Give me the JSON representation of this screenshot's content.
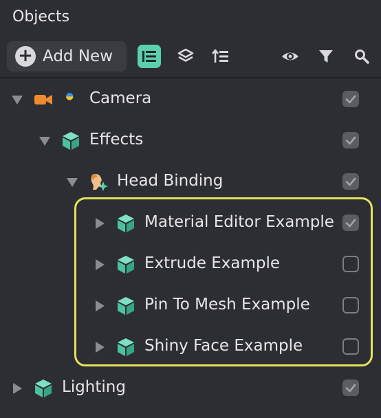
{
  "panel": {
    "title": "Objects"
  },
  "toolbar": {
    "add_label": "Add New",
    "icons": [
      "list-tree-icon",
      "layers-icon",
      "sort-hierarchy-icon",
      "eye-icon",
      "filter-icon",
      "search-icon"
    ],
    "active_icon": "list-tree-icon",
    "accent": "#5ad0ae"
  },
  "tree": [
    {
      "label": "Camera",
      "expanded": true,
      "icon": "camera-icon",
      "checked": true,
      "depth": 0
    },
    {
      "label": "Effects",
      "expanded": true,
      "icon": "cube-icon",
      "checked": true,
      "depth": 1
    },
    {
      "label": "Head Binding",
      "expanded": true,
      "icon": "head-binding-icon",
      "checked": true,
      "depth": 2
    },
    {
      "label": "Material Editor Example",
      "expanded": false,
      "icon": "cube-icon",
      "checked": true,
      "depth": 3
    },
    {
      "label": "Extrude Example",
      "expanded": false,
      "icon": "cube-icon",
      "checked": false,
      "depth": 3
    },
    {
      "label": "Pin To Mesh Example",
      "expanded": false,
      "icon": "cube-icon",
      "checked": false,
      "depth": 3
    },
    {
      "label": "Shiny Face Example",
      "expanded": false,
      "icon": "cube-icon",
      "checked": false,
      "depth": 3
    },
    {
      "label": "Lighting",
      "expanded": false,
      "icon": "cube-icon",
      "checked": true,
      "depth": 0
    }
  ],
  "highlight_color": "#e6e25a"
}
